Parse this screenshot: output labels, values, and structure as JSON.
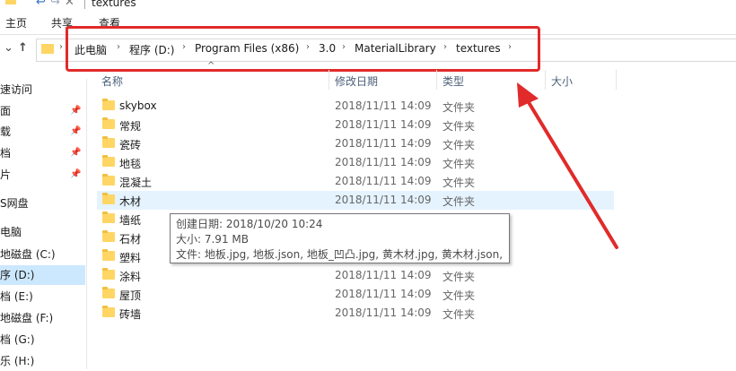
{
  "window": {
    "title": "textures"
  },
  "ribbon": {
    "tabs": [
      "主页",
      "共享",
      "查看"
    ]
  },
  "address": {
    "crumbs": [
      "此电脑",
      "程序 (D:)",
      "Program Files (x86)",
      "3.0",
      "MaterialLibrary",
      "textures"
    ]
  },
  "sidebar": {
    "items": [
      {
        "label": "速访问",
        "pinned": false,
        "selected": false
      },
      {
        "label": "面",
        "pinned": true,
        "selected": false
      },
      {
        "label": "载",
        "pinned": true,
        "selected": false
      },
      {
        "label": "档",
        "pinned": true,
        "selected": false
      },
      {
        "label": "片",
        "pinned": true,
        "selected": false
      },
      {
        "label": "S网盘",
        "pinned": false,
        "selected": false
      },
      {
        "label": "电脑",
        "pinned": false,
        "selected": false
      },
      {
        "label": "地磁盘 (C:)",
        "pinned": false,
        "selected": false
      },
      {
        "label": "序 (D:)",
        "pinned": false,
        "selected": true
      },
      {
        "label": "档 (E:)",
        "pinned": false,
        "selected": false
      },
      {
        "label": "地磁盘 (F:)",
        "pinned": false,
        "selected": false
      },
      {
        "label": "档 (G:)",
        "pinned": false,
        "selected": false
      },
      {
        "label": "乐 (H:)",
        "pinned": false,
        "selected": false
      }
    ]
  },
  "columns": {
    "name": "名称",
    "date": "修改日期",
    "type": "类型",
    "size": "大小"
  },
  "files": [
    {
      "name": "skybox",
      "date": "2018/11/11 14:09",
      "type": "文件夹"
    },
    {
      "name": "常规",
      "date": "2018/11/11 14:09",
      "type": "文件夹"
    },
    {
      "name": "瓷砖",
      "date": "2018/11/11 14:09",
      "type": "文件夹"
    },
    {
      "name": "地毯",
      "date": "2018/11/11 14:09",
      "type": "文件夹"
    },
    {
      "name": "混凝土",
      "date": "2018/11/11 14:09",
      "type": "文件夹"
    },
    {
      "name": "木材",
      "date": "2018/11/11 14:09",
      "type": "文件夹"
    },
    {
      "name": "墙纸",
      "date": "",
      "type": ""
    },
    {
      "name": "石材",
      "date": "",
      "type": ""
    },
    {
      "name": "塑料",
      "date": "",
      "type": ""
    },
    {
      "name": "涂料",
      "date": "2018/11/11 14:09",
      "type": "文件夹"
    },
    {
      "name": "屋顶",
      "date": "2018/11/11 14:09",
      "type": "文件夹"
    },
    {
      "name": "砖墙",
      "date": "2018/11/11 14:09",
      "type": "文件夹"
    }
  ],
  "tooltip": {
    "created": "创建日期: 2018/10/20 10:24",
    "size": "大小: 7.91 MB",
    "files": "文件: 地板.jpg, 地板.json, 地板_凹凸.jpg, 黄木材.jpg, 黄木材.json, ..."
  },
  "colors": {
    "highlight": "#e12a2a",
    "hover_row": "#e5f3ff",
    "selected_sidebar": "#cce8ff",
    "folder": "#ffd664"
  }
}
